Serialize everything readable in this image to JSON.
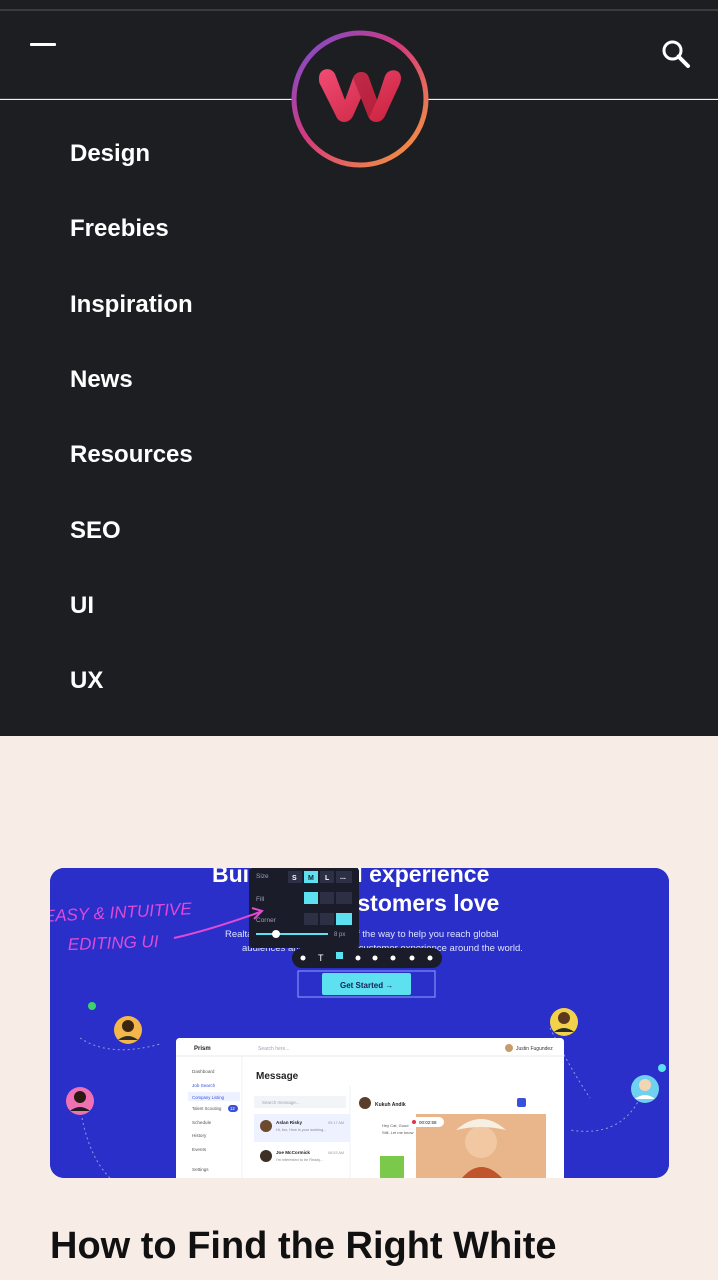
{
  "header": {
    "menu_icon": "minus-icon",
    "search_icon": "search-icon",
    "logo": "w-logo"
  },
  "menu": {
    "items": [
      {
        "label": "Design"
      },
      {
        "label": "Freebies"
      },
      {
        "label": "Inspiration"
      },
      {
        "label": "News"
      },
      {
        "label": "Resources"
      },
      {
        "label": "SEO"
      },
      {
        "label": "UI"
      },
      {
        "label": "UX"
      }
    ]
  },
  "article": {
    "hero": {
      "heading_line1": "Build a global experience",
      "heading_line2": "that customers love",
      "subtext_line1": "Realtalk helps you every step of the way to help you reach global",
      "subtext_line2": "audiences and improve the customer experience around the world.",
      "cta": "Get Started →",
      "annotation_line1": "EASY & INTUITIVE",
      "annotation_line2": "EDITING UI",
      "editor": {
        "size_label": "Size",
        "size_options": [
          "S",
          "M",
          "L",
          "..."
        ],
        "fill_label": "Fill",
        "corner_label": "Corner",
        "slider_value": "8 px"
      },
      "app": {
        "brand": "Prism",
        "search_placeholder": "Search here...",
        "user": "Justin Fugundez",
        "nav": [
          "Dashboard",
          "Job Search",
          "Company Listing",
          "Talent Scouting",
          "Schedule",
          "History",
          "Events",
          "Settings"
        ],
        "nav_badge": "12",
        "page_title": "Message",
        "message_search": "Search message...",
        "contacts": [
          {
            "name": "Aslan Risky",
            "time": "09:17 AM",
            "preview": "Hi, bro, How is your working..."
          },
          {
            "name": "Joe McCormick",
            "time": "08:53 AM",
            "preview": "I'm interested to be Ready..."
          }
        ],
        "chat_with": "Kukuh Andik",
        "chat_message_line1": "Hey Cat, Good",
        "chat_message_line2": "Still, Let me know",
        "call_timer": "00:02:58"
      }
    },
    "title": "How to Find the Right White"
  },
  "colors": {
    "header_bg": "#1d1e22",
    "page_bg": "#f7ece6",
    "card_bg": "#2a2fc9",
    "accent_cyan": "#5de0f0",
    "annotation_pink": "#e04ad6"
  }
}
